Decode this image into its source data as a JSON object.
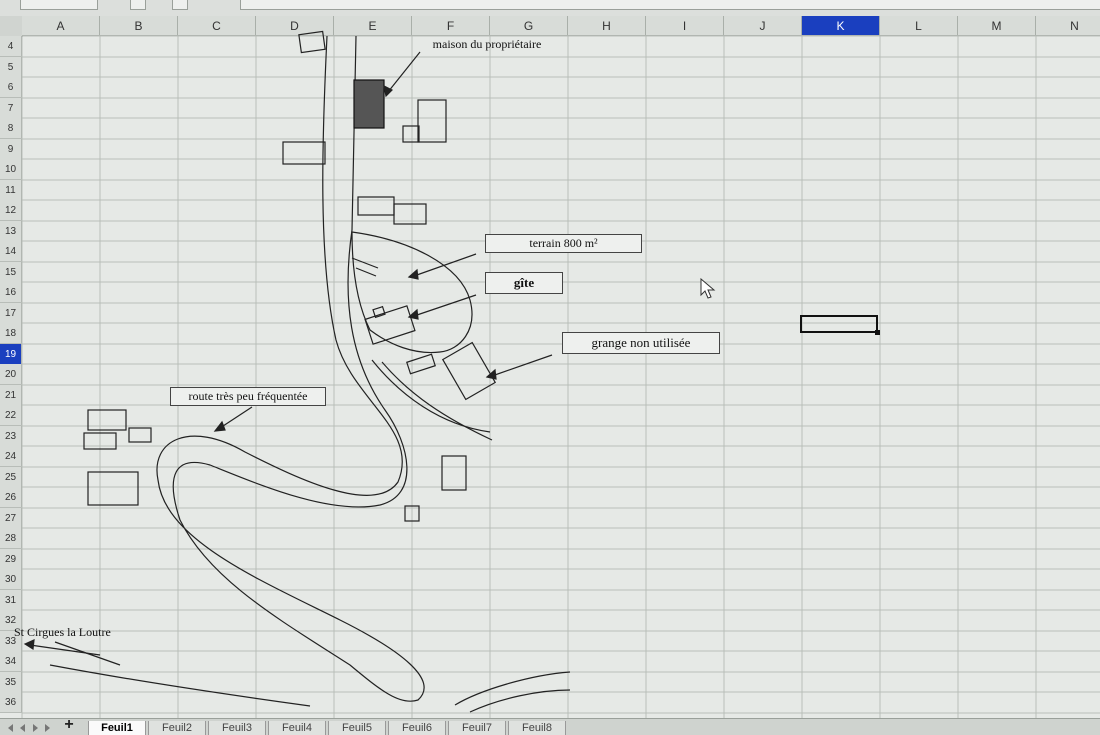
{
  "spreadsheet": {
    "columns": [
      "A",
      "B",
      "C",
      "D",
      "E",
      "F",
      "G",
      "H",
      "I",
      "J",
      "K",
      "L",
      "M",
      "N"
    ],
    "active_column": "K",
    "rows": [
      "4",
      "5",
      "6",
      "7",
      "8",
      "9",
      "10",
      "11",
      "12",
      "13",
      "14",
      "15",
      "16",
      "17",
      "18",
      "19",
      "20",
      "21",
      "22",
      "23",
      "24",
      "25",
      "26",
      "27",
      "28",
      "29",
      "30",
      "31",
      "32",
      "33",
      "34",
      "35",
      "36"
    ],
    "active_row": "19"
  },
  "map_labels": {
    "owner_house": "maison du propriétaire",
    "land": "terrain   800 m²",
    "gite": "gîte",
    "barn": "grange non utilisée",
    "road": "route très peu fréquentée",
    "town": "St Cirgues la Loutre"
  },
  "sheet_tabs": [
    {
      "label": "Feuil1",
      "active": true
    },
    {
      "label": "Feuil2",
      "active": false
    },
    {
      "label": "Feuil3",
      "active": false
    },
    {
      "label": "Feuil4",
      "active": false
    },
    {
      "label": "Feuil5",
      "active": false
    },
    {
      "label": "Feuil6",
      "active": false
    },
    {
      "label": "Feuil7",
      "active": false
    },
    {
      "label": "Feuil8",
      "active": false
    }
  ],
  "add_sheet_label": "+",
  "colors": {
    "active_header": "#1a3fbf",
    "grid_line": "#b9beb9",
    "drawing": "#222222"
  }
}
